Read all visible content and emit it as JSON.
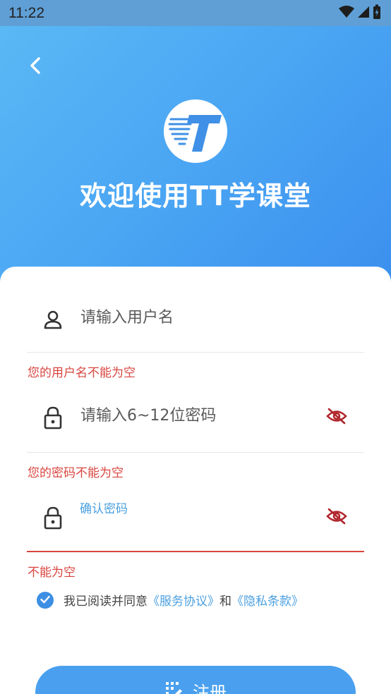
{
  "status_bar": {
    "time": "11:22"
  },
  "header": {
    "title": "欢迎使用TT学课堂"
  },
  "form": {
    "username": {
      "placeholder": "请输入用户名",
      "value": "",
      "error": "您的用户名不能为空"
    },
    "password": {
      "placeholder": "请输入6~12位密码",
      "value": "",
      "error": "您的密码不能为空"
    },
    "confirm": {
      "label": "确认密码",
      "value": "",
      "error": "不能为空"
    }
  },
  "agreement": {
    "checked": true,
    "prefix": "我已阅读并同意",
    "service_link": "《服务协议》",
    "conjunction": "和",
    "privacy_link": "《隐私条款》"
  },
  "register_button": {
    "label": "注册"
  },
  "colors": {
    "primary": "#4aa0ee",
    "error": "#d8453f",
    "link": "#4a9fe0"
  },
  "icons": [
    "back-arrow-icon",
    "logo-icon",
    "user-icon",
    "lock-icon",
    "eye-off-icon",
    "check-icon",
    "register-icon",
    "wifi-icon",
    "signal-icon",
    "battery-icon"
  ]
}
